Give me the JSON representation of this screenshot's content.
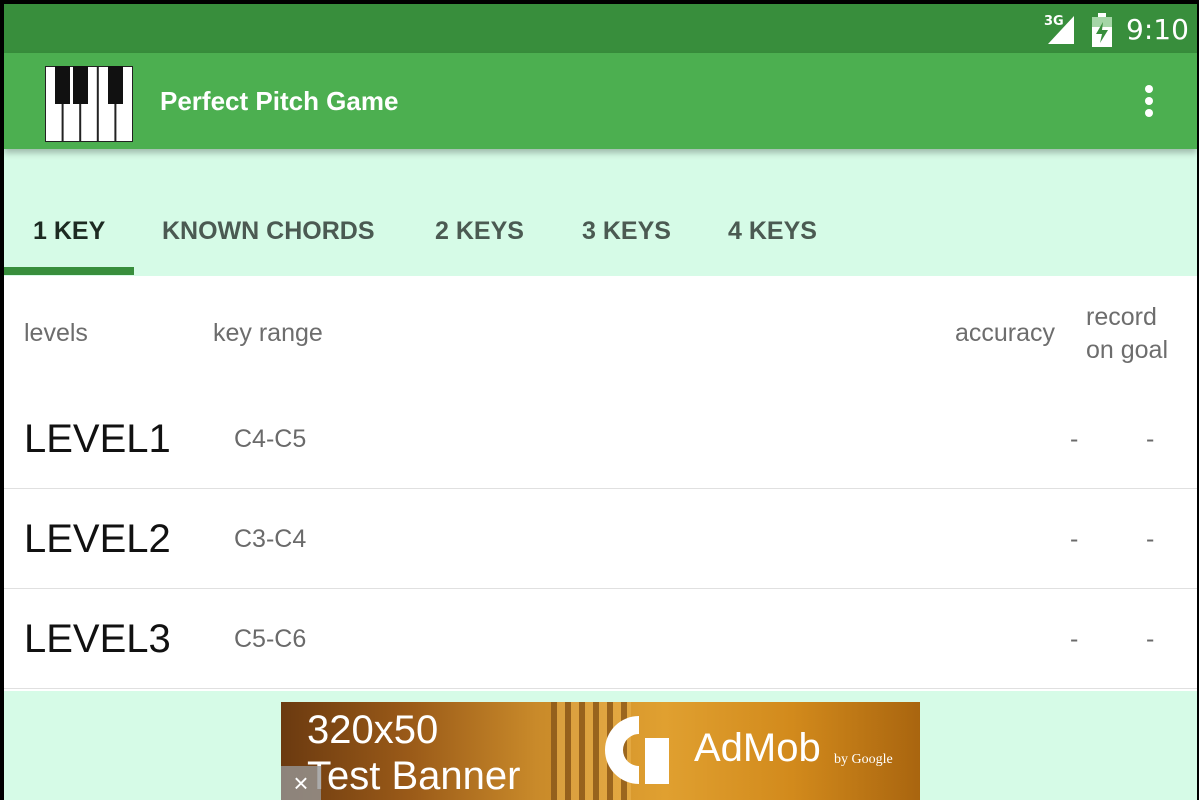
{
  "status_bar": {
    "network": "3G",
    "time": "9:10"
  },
  "app_bar": {
    "title": "Perfect Pitch Game",
    "overflow_icon": "more-vert-icon",
    "logo_icon": "piano-keys-icon"
  },
  "tabs": [
    {
      "label": "1 KEY",
      "active": true
    },
    {
      "label": "KNOWN CHORDS",
      "active": false
    },
    {
      "label": "2 KEYS",
      "active": false
    },
    {
      "label": "3 KEYS",
      "active": false
    },
    {
      "label": "4 KEYS",
      "active": false
    }
  ],
  "table": {
    "headers": {
      "levels": "levels",
      "key_range": "key range",
      "accuracy": "accuracy",
      "record_line1": "record",
      "record_line2": "on goal"
    },
    "rows": [
      {
        "level": "LEVEL1",
        "range": "C4-C5",
        "accuracy": "-",
        "record": "-"
      },
      {
        "level": "LEVEL2",
        "range": "C3-C4",
        "accuracy": "-",
        "record": "-"
      },
      {
        "level": "LEVEL3",
        "range": "C5-C6",
        "accuracy": "-",
        "record": "-"
      }
    ]
  },
  "ad": {
    "line1": "320x50",
    "line2": "Test Banner",
    "brand": "AdMob",
    "by": "by Google",
    "close": "×"
  },
  "colors": {
    "status_bar": "#388e3c",
    "app_bar": "#4caf50",
    "background": "#d6fbe7",
    "tab_indicator": "#388e3c"
  }
}
